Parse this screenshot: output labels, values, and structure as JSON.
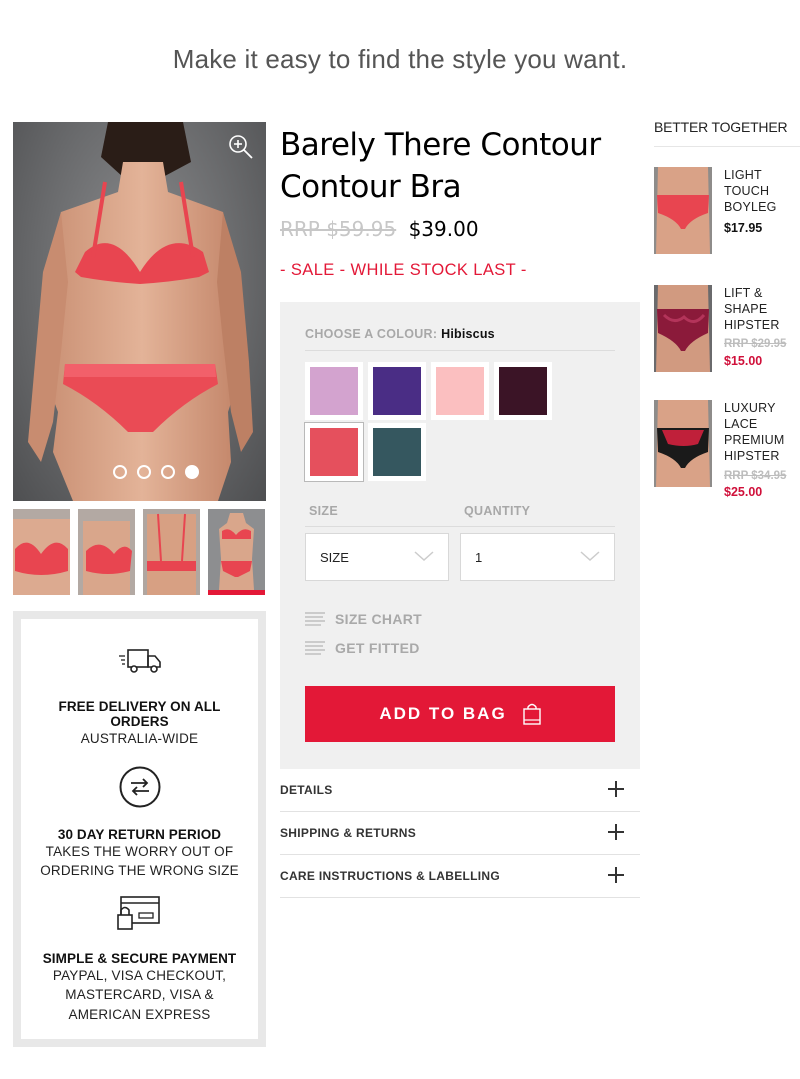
{
  "headline": "Make it easy to find the style you want.",
  "gallery": {
    "zoom_icon": "zoom-in-icon",
    "dots": 4,
    "active_dot": 4,
    "thumbnails": [
      "front-view",
      "side-view",
      "back-view",
      "full-view"
    ],
    "active_thumbnail": 4
  },
  "features": [
    {
      "icon": "truck-icon",
      "title": "FREE DELIVERY ON ALL ORDERS",
      "text": "AUSTRALIA-WIDE"
    },
    {
      "icon": "exchange-arrows-icon",
      "title": "30 DAY RETURN PERIOD",
      "text": "TAKES THE WORRY OUT OF ORDERING THE WRONG SIZE"
    },
    {
      "icon": "secure-card-icon",
      "title": "SIMPLE & SECURE PAYMENT",
      "text": "PAYPAL, VISA CHECKOUT, MASTERCARD, VISA & AMERICAN EXPRESS"
    }
  ],
  "product": {
    "title_line1": "Barely There Contour",
    "title_line2": "Contour Bra",
    "price_old": "RRP $59.95",
    "price_new": "$39.00",
    "sale": "- SALE - WHILE STOCK LAST -"
  },
  "options": {
    "colour_label": "CHOOSE A COLOUR: ",
    "colour_value": "Hibiscus",
    "swatches": [
      "#d3a3cf",
      "#4a2d85",
      "#fbbfc0",
      "#3b1426",
      "#e5505d",
      "#35575f"
    ],
    "selected_swatch": 4,
    "size_label": "SIZE",
    "quantity_label": "QUANTITY",
    "size_value": "SIZE",
    "quantity_value": "1",
    "size_chart": "SIZE CHART",
    "get_fitted": "GET FITTED",
    "add_to_bag": "ADD TO BAG"
  },
  "accordion": [
    "DETAILS",
    "SHIPPING & RETURNS",
    "CARE INSTRUCTIONS & LABELLING"
  ],
  "better_together": {
    "title": "BETTER TOGETHER",
    "items": [
      {
        "name": [
          "LIGHT",
          "TOUCH",
          "BOYLEG"
        ],
        "price_old": "",
        "price": "$17.95",
        "price_color": "#111111"
      },
      {
        "name": [
          "LIFT &",
          "SHAPE",
          "HIPSTER"
        ],
        "price_old": "RRP $29.95",
        "price": "$15.00",
        "price_color": "#d0103a"
      },
      {
        "name": [
          "LUXURY",
          "LACE",
          "PREMIUM",
          "HIPSTER"
        ],
        "price_old": "RRP $34.95",
        "price": "$25.00",
        "price_color": "#d0103a"
      }
    ]
  },
  "colors": {
    "accent": "#e31837",
    "panel": "#f0f0f0"
  }
}
